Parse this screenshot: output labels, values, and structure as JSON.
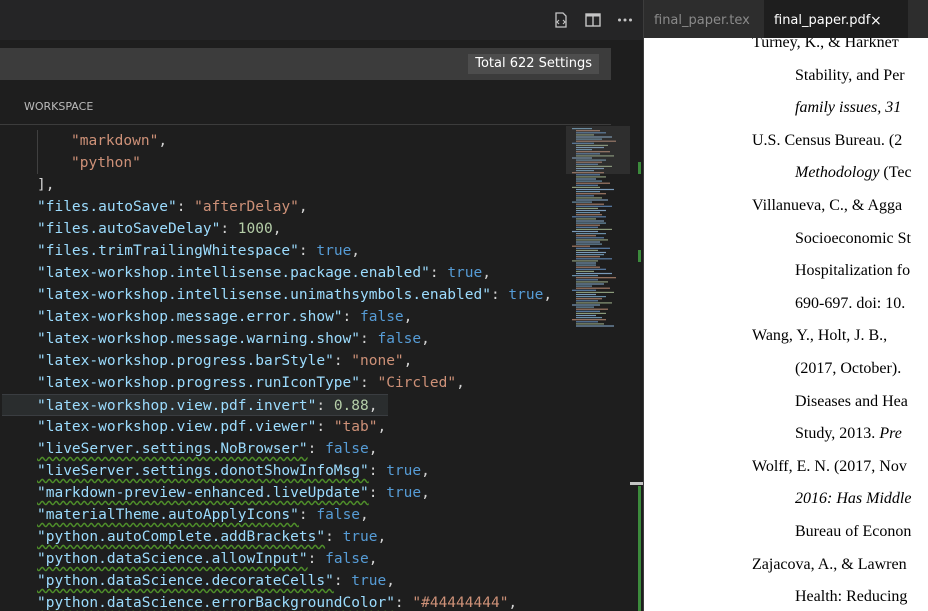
{
  "toolbar": {
    "icons": [
      "open-settings-json-icon",
      "split-editor-icon",
      "more-actions-icon"
    ]
  },
  "search": {
    "total_settings": "Total 622 Settings"
  },
  "scope": {
    "workspace_label": "WORKSPACE"
  },
  "editor": {
    "lines": [
      [
        {
          "t": "\"markdown\"",
          "c": "str"
        },
        {
          "t": ",",
          "c": "p"
        }
      ],
      [
        {
          "t": "\"python\"",
          "c": "str"
        }
      ],
      [
        {
          "t": "],",
          "c": "p"
        }
      ],
      [
        {
          "t": "\"files.autoSave\"",
          "c": "key"
        },
        {
          "t": ": ",
          "c": "p"
        },
        {
          "t": "\"afterDelay\"",
          "c": "str"
        },
        {
          "t": ",",
          "c": "p"
        }
      ],
      [
        {
          "t": "\"files.autoSaveDelay\"",
          "c": "key"
        },
        {
          "t": ": ",
          "c": "p"
        },
        {
          "t": "1000",
          "c": "num"
        },
        {
          "t": ",",
          "c": "p"
        }
      ],
      [
        {
          "t": "\"files.trimTrailingWhitespace\"",
          "c": "key"
        },
        {
          "t": ": ",
          "c": "p"
        },
        {
          "t": "true",
          "c": "bool"
        },
        {
          "t": ",",
          "c": "p"
        }
      ],
      [
        {
          "t": "\"latex-workshop.intellisense.package.enabled\"",
          "c": "key"
        },
        {
          "t": ": ",
          "c": "p"
        },
        {
          "t": "true",
          "c": "bool"
        },
        {
          "t": ",",
          "c": "p"
        }
      ],
      [
        {
          "t": "\"latex-workshop.intellisense.unimathsymbols.enabled\"",
          "c": "key"
        },
        {
          "t": ": ",
          "c": "p"
        },
        {
          "t": "true",
          "c": "bool"
        },
        {
          "t": ",",
          "c": "p"
        }
      ],
      [
        {
          "t": "\"latex-workshop.message.error.show\"",
          "c": "key"
        },
        {
          "t": ": ",
          "c": "p"
        },
        {
          "t": "false",
          "c": "bool"
        },
        {
          "t": ",",
          "c": "p"
        }
      ],
      [
        {
          "t": "\"latex-workshop.message.warning.show\"",
          "c": "key"
        },
        {
          "t": ": ",
          "c": "p"
        },
        {
          "t": "false",
          "c": "bool"
        },
        {
          "t": ",",
          "c": "p"
        }
      ],
      [
        {
          "t": "\"latex-workshop.progress.barStyle\"",
          "c": "key"
        },
        {
          "t": ": ",
          "c": "p"
        },
        {
          "t": "\"none\"",
          "c": "str"
        },
        {
          "t": ",",
          "c": "p"
        }
      ],
      [
        {
          "t": "\"latex-workshop.progress.runIconType\"",
          "c": "key"
        },
        {
          "t": ": ",
          "c": "p"
        },
        {
          "t": "\"Circled\"",
          "c": "str"
        },
        {
          "t": ",",
          "c": "p"
        }
      ],
      [
        {
          "t": "\"latex-workshop.view.pdf.invert\"",
          "c": "key"
        },
        {
          "t": ": ",
          "c": "p"
        },
        {
          "t": "0.88",
          "c": "num"
        },
        {
          "t": ",",
          "c": "p"
        }
      ],
      [
        {
          "t": "\"latex-workshop.view.pdf.viewer\"",
          "c": "key"
        },
        {
          "t": ": ",
          "c": "p"
        },
        {
          "t": "\"tab\"",
          "c": "str"
        },
        {
          "t": ",",
          "c": "p"
        }
      ],
      [
        {
          "t": "\"liveServer.settings.NoBrowser\"",
          "c": "key"
        },
        {
          "t": ": ",
          "c": "p"
        },
        {
          "t": "false",
          "c": "bool"
        },
        {
          "t": ",",
          "c": "p"
        }
      ],
      [
        {
          "t": "\"liveServer.settings.donotShowInfoMsg\"",
          "c": "key"
        },
        {
          "t": ": ",
          "c": "p"
        },
        {
          "t": "true",
          "c": "bool"
        },
        {
          "t": ",",
          "c": "p"
        }
      ],
      [
        {
          "t": "\"markdown-preview-enhanced.liveUpdate\"",
          "c": "key"
        },
        {
          "t": ": ",
          "c": "p"
        },
        {
          "t": "true",
          "c": "bool"
        },
        {
          "t": ",",
          "c": "p"
        }
      ],
      [
        {
          "t": "\"materialTheme.autoApplyIcons\"",
          "c": "key"
        },
        {
          "t": ": ",
          "c": "p"
        },
        {
          "t": "false",
          "c": "bool"
        },
        {
          "t": ",",
          "c": "p"
        }
      ],
      [
        {
          "t": "\"python.autoComplete.addBrackets\"",
          "c": "key"
        },
        {
          "t": ": ",
          "c": "p"
        },
        {
          "t": "true",
          "c": "bool"
        },
        {
          "t": ",",
          "c": "p"
        }
      ],
      [
        {
          "t": "\"python.dataScience.allowInput\"",
          "c": "key"
        },
        {
          "t": ": ",
          "c": "p"
        },
        {
          "t": "false",
          "c": "bool"
        },
        {
          "t": ",",
          "c": "p"
        }
      ],
      [
        {
          "t": "\"python.dataScience.decorateCells\"",
          "c": "key"
        },
        {
          "t": ": ",
          "c": "p"
        },
        {
          "t": "true",
          "c": "bool"
        },
        {
          "t": ",",
          "c": "p"
        }
      ],
      [
        {
          "t": "\"python.dataScience.errorBackgroundColor\"",
          "c": "key"
        },
        {
          "t": ": ",
          "c": "p"
        },
        {
          "t": "\"#44444444\"",
          "c": "str"
        },
        {
          "t": ",",
          "c": "p"
        }
      ]
    ],
    "highlighted_line": 12,
    "squiggle_lines": [
      14,
      15,
      16,
      17,
      18,
      19,
      20,
      21
    ]
  },
  "tabs": {
    "tab1": "final_paper.tex",
    "tab2": "final_paper.pdf",
    "close_glyph": "×"
  },
  "pdf": {
    "lines": [
      [
        {
          "t": "Turney, K., & Harkneт",
          "i": false
        }
      ],
      [
        {
          "t": "Stability, and Per",
          "i": false
        }
      ],
      [
        {
          "t": "family issues, 31",
          "i": true
        }
      ],
      [
        {
          "t": "U.S. Census Bureau. (2",
          "i": false
        }
      ],
      [
        {
          "t": "Methodology",
          "i": true
        },
        {
          "t": " (Tec",
          "i": false
        }
      ],
      [
        {
          "t": "Villanueva, C., & Agga",
          "i": false
        }
      ],
      [
        {
          "t": "Socioeconomic St",
          "i": false
        }
      ],
      [
        {
          "t": "Hospitalization fo",
          "i": false
        }
      ],
      [
        {
          "t": "690-697. doi: 10.",
          "i": false
        }
      ],
      [
        {
          "t": "Wang, Y., Holt, J. B., ",
          "i": false
        }
      ],
      [
        {
          "t": "(2017, October). ",
          "i": false
        }
      ],
      [
        {
          "t": "Diseases and Hea",
          "i": false
        }
      ],
      [
        {
          "t": "Study, 2013. ",
          "i": false
        },
        {
          "t": "Pre",
          "i": true
        }
      ],
      [
        {
          "t": "Wolff, E. N. (2017, Nov",
          "i": false
        }
      ],
      [
        {
          "t": "2016: Has Middle",
          "i": true
        }
      ],
      [
        {
          "t": "Bureau of Econon",
          "i": false
        }
      ],
      [
        {
          "t": "Zajacova, A., & Lawren",
          "i": false
        }
      ],
      [
        {
          "t": "Health: Reducing",
          "i": false
        }
      ]
    ]
  },
  "colors": {
    "key": "#9cdcfe",
    "string": "#ce9178",
    "number": "#b5cea8",
    "boolean": "#569cd6",
    "punct": "#d4d4d4",
    "editor_bg": "#1e1e1e"
  }
}
